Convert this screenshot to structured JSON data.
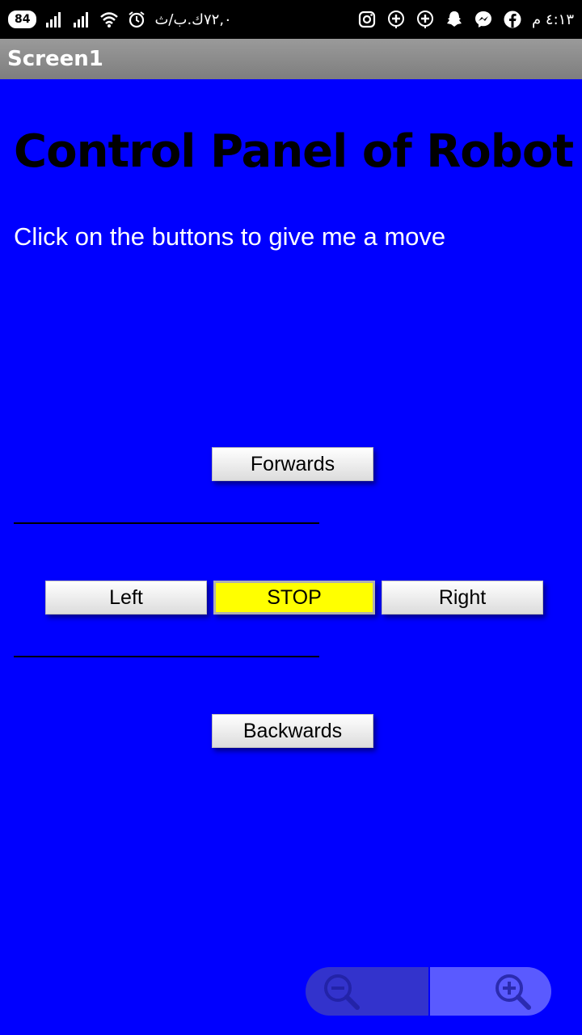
{
  "status_bar": {
    "battery": "84",
    "network_speed": "٧٢,٠ك.ب/ث",
    "clock": "٤:١٣ م",
    "icons_left": [
      "signal-icon",
      "signal-icon",
      "wifi-icon",
      "alarm-icon"
    ],
    "icons_right": [
      "instagram-icon",
      "add-circle-icon",
      "add-circle-icon",
      "snapchat-icon",
      "messenger-icon",
      "facebook-icon"
    ]
  },
  "app": {
    "title": "Screen1"
  },
  "main": {
    "heading": "Control Panel of Robot",
    "subtitle": "Click on the buttons to give me a move",
    "divider_text": "",
    "buttons": {
      "forwards": "Forwards",
      "left": "Left",
      "stop": "STOP",
      "right": "Right",
      "backwards": "Backwards"
    }
  },
  "zoom": {
    "out_icon": "zoom-out-icon",
    "in_icon": "zoom-in-icon"
  },
  "colors": {
    "background": "#0000ff",
    "stop_button": "#ffff00",
    "titlebar": "#8c8c8c"
  }
}
